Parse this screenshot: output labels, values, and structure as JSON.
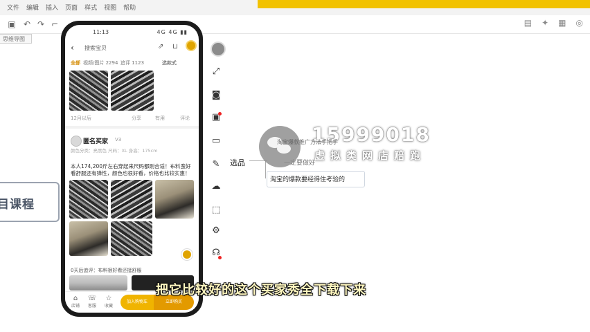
{
  "app": {
    "menu": [
      "文件",
      "编辑",
      "插入",
      "页面",
      "样式",
      "视图",
      "帮助"
    ],
    "doc_tab": "思维导图"
  },
  "course_label": "目课程",
  "phone": {
    "time": "11:13",
    "signal": "4G 4G ▮▮",
    "search_label": "搜索宝贝",
    "filters": {
      "all": "全部",
      "video": "视频/图片 2294",
      "add": "追评 1123",
      "sort": "选款式"
    },
    "post1_meta": {
      "left": "12月以后",
      "share": "分享",
      "like": "有用",
      "comment": "评论"
    },
    "user": {
      "name": "匿名买家",
      "tag": "V3"
    },
    "spec_text": "颜色分类：亮黑色 尺码：XL 身高：175cm",
    "review_text": "本人174,200斤左右穿起来尺码都刚合适！布料蛮好看舒服还有弹性，颜色也很好看，价格也比较实惠！",
    "comment_line": "0天后追评：布料很好看还挺舒服",
    "bottom": {
      "shop": "店铺",
      "service": "客服",
      "fav": "收藏",
      "add_cart": "加入购物车",
      "buy": "立即购买"
    }
  },
  "mindmap": {
    "node": "选品",
    "child_top": "一定要做好",
    "child": "淘宝的爆款要经得住考验的"
  },
  "watermark": {
    "number": "15999018",
    "sub": "虚拟类网店赔跑",
    "overlay": "淘宝爆款推广方法手把手"
  },
  "subtitle": "把它比较好的这个买家秀全下载下来"
}
